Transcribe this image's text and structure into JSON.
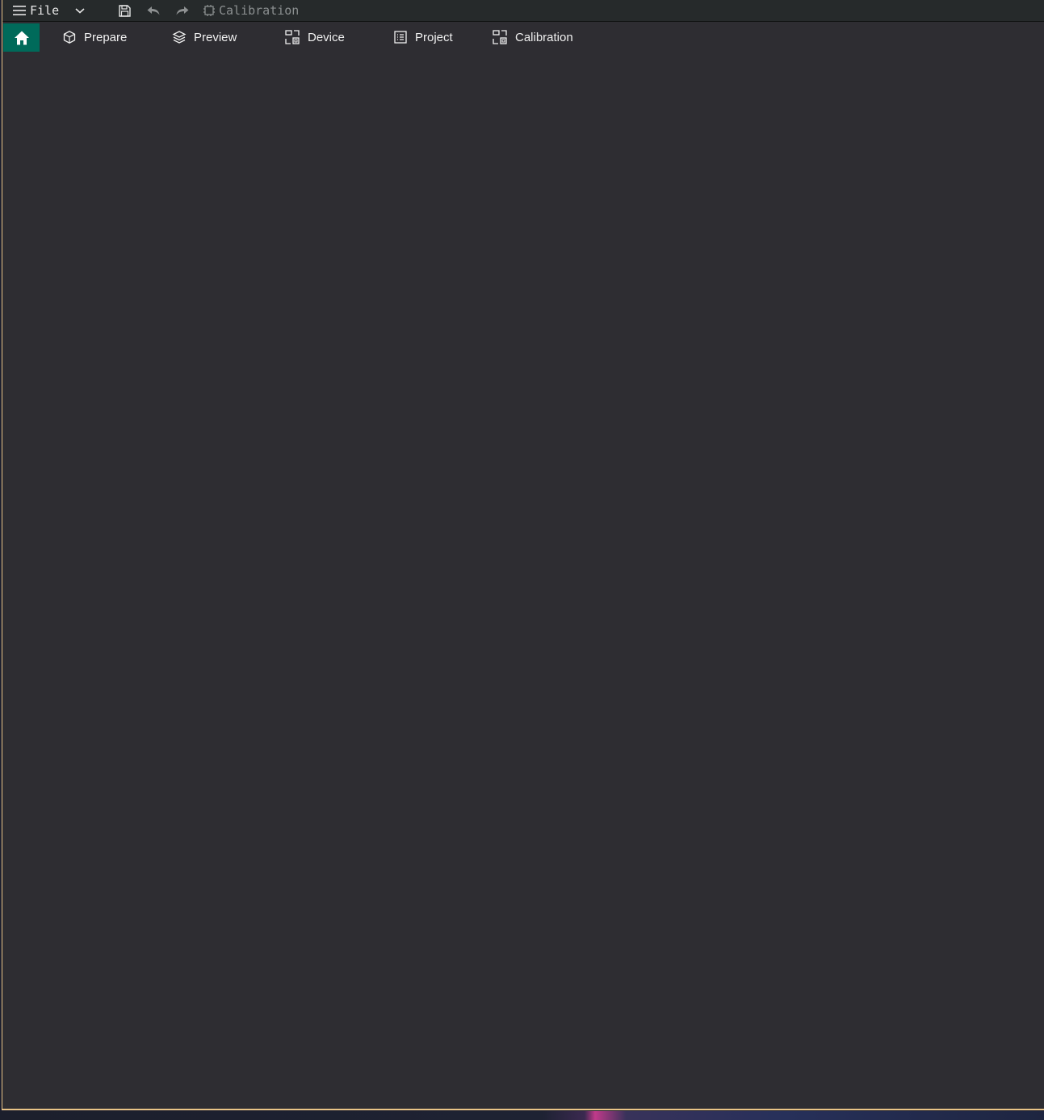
{
  "titlebar": {
    "menu_label": "File",
    "title": "Calibration",
    "icons": [
      "hamburger-menu-icon",
      "chevron-down-icon",
      "save-icon",
      "undo-icon",
      "redo-icon",
      "calibration-icon"
    ]
  },
  "navbar": {
    "home_icon": "home-icon",
    "tabs": [
      {
        "label": "Prepare",
        "icon": "cube-icon"
      },
      {
        "label": "Preview",
        "icon": "layers-icon"
      },
      {
        "label": "Device",
        "icon": "device-icon"
      },
      {
        "label": "Project",
        "icon": "list-icon"
      },
      {
        "label": "Calibration",
        "icon": "calibration-icon"
      }
    ]
  },
  "colors": {
    "accent": "#006a5a",
    "background": "#2e2d32",
    "titlebar": "#262a2b",
    "window_border": "#e9c487"
  }
}
